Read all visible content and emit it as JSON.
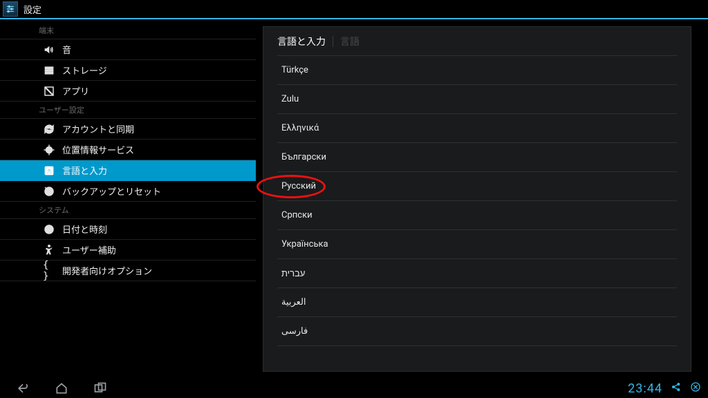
{
  "titlebar": {
    "title": "設定"
  },
  "sidebar": {
    "sections": [
      {
        "header": "端末",
        "items": [
          {
            "icon": "volume-icon",
            "label": "音"
          },
          {
            "icon": "storage-icon",
            "label": "ストレージ"
          },
          {
            "icon": "apps-icon",
            "label": "アプリ"
          }
        ]
      },
      {
        "header": "ユーザー設定",
        "items": [
          {
            "icon": "sync-icon",
            "label": "アカウントと同期"
          },
          {
            "icon": "location-icon",
            "label": "位置情報サービス"
          },
          {
            "icon": "language-icon",
            "label": "言語と入力",
            "selected": true
          },
          {
            "icon": "backup-icon",
            "label": "バックアップとリセット"
          }
        ]
      },
      {
        "header": "システム",
        "items": [
          {
            "icon": "clock-icon",
            "label": "日付と時刻"
          },
          {
            "icon": "accessibility-icon",
            "label": "ユーザー補助"
          },
          {
            "icon": "developer-icon",
            "label": "開発者向けオプション"
          }
        ]
      }
    ]
  },
  "panel": {
    "crumb_main": "言語と入力",
    "crumb_sub": "言語",
    "items": [
      "Türkçe",
      "Zulu",
      "Ελληνικά",
      "Български",
      "Русский",
      "Српски",
      "Українська",
      "עברית",
      "العربية",
      "فارسی"
    ],
    "highlight_index": 4
  },
  "navbar": {
    "clock": "23:44"
  },
  "colors": {
    "accent": "#33b5e5",
    "highlight": "#0099cc",
    "annotation": "#e11"
  }
}
